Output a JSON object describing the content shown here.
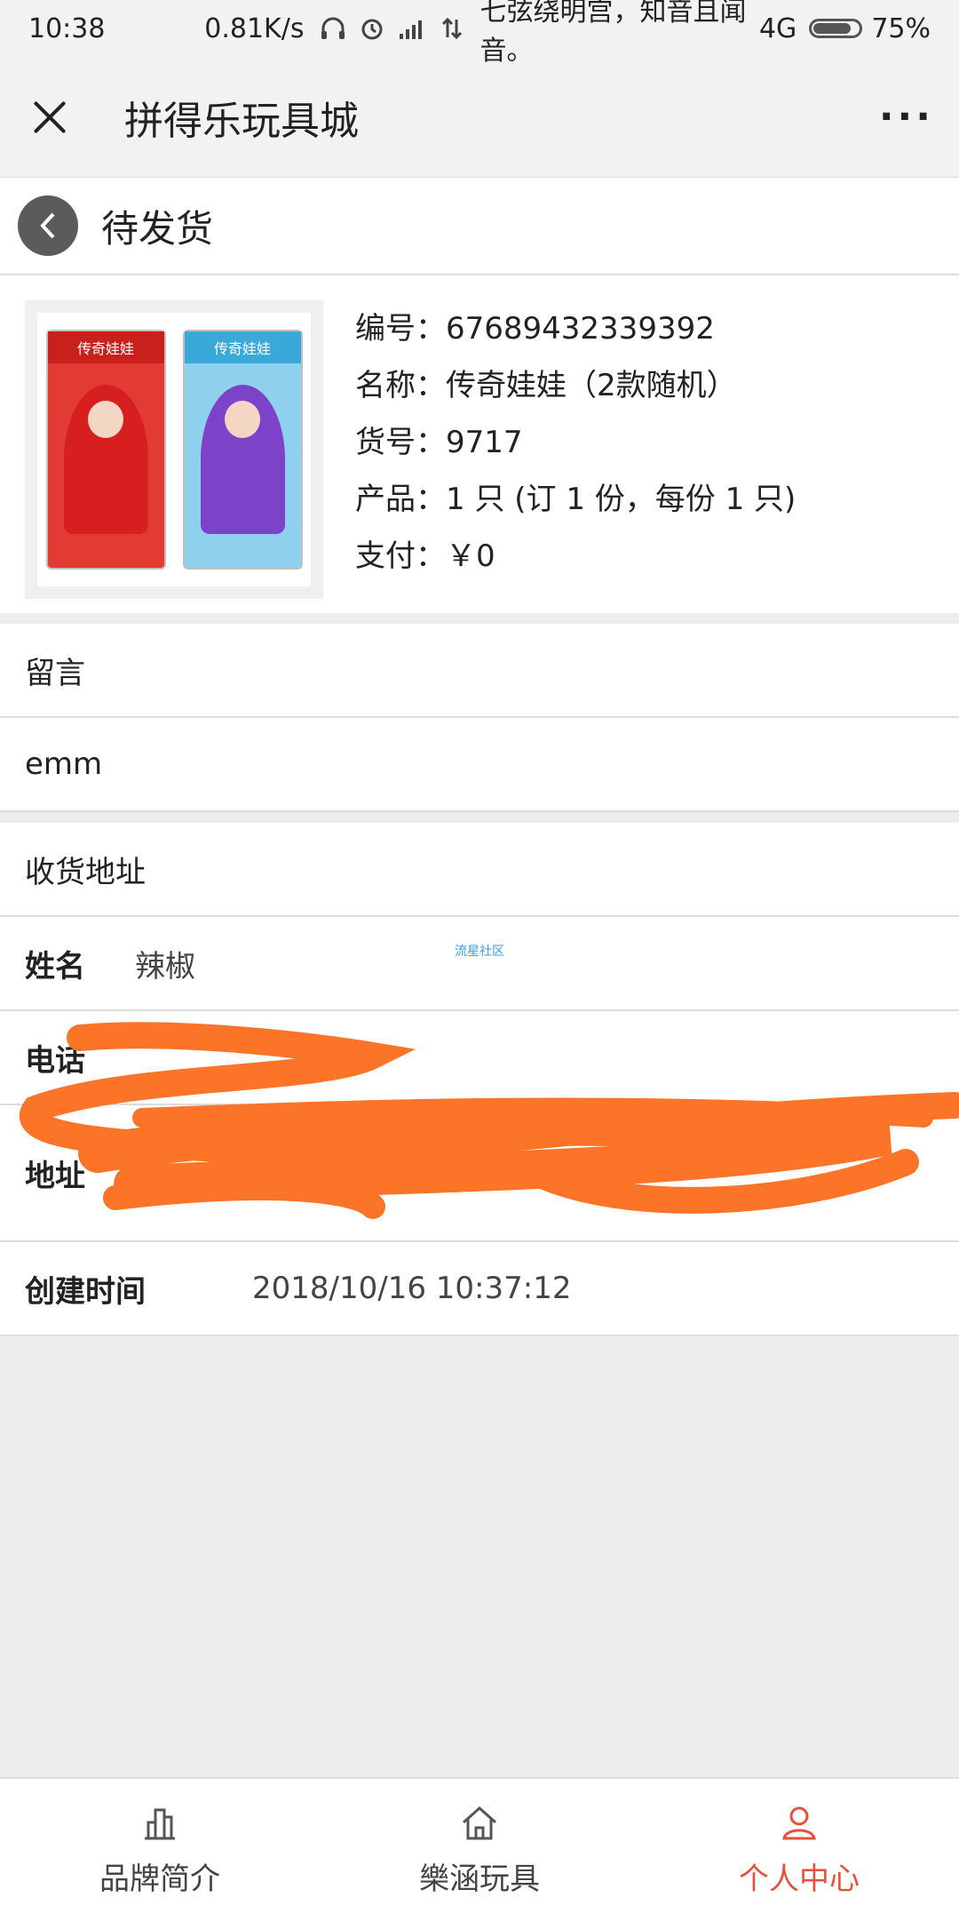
{
  "status_bar": {
    "time": "10:38",
    "speed": "0.81K/s",
    "motto": "七弦绕明宫，知音且闻音。",
    "network": "4G",
    "battery": "75%"
  },
  "header": {
    "title": "拼得乐玩具城"
  },
  "subheader": {
    "label": "待发货"
  },
  "product": {
    "id_line": "编号：67689432339392",
    "name_line": "名称：传奇娃娃（2款随机）",
    "sku_line": "货号：9717",
    "qty_line": "产品：1 只 (订 1 份，每份 1 只)",
    "pay_line": "支付：￥0",
    "box_label": "传奇娃娃"
  },
  "message": {
    "label": "留言",
    "value": "emm"
  },
  "address": {
    "section_label": "收货地址",
    "name_label": "姓名",
    "name_value": "辣椒",
    "watermark": "流星社区",
    "phone_label": "电话",
    "addr_label": "地址"
  },
  "created": {
    "label": "创建时间",
    "value": "2018/10/16 10:37:12"
  },
  "tabs": [
    {
      "label": "品牌简介"
    },
    {
      "label": "樂涵玩具"
    },
    {
      "label": "个人中心"
    }
  ],
  "colors": {
    "accent": "#e4523b",
    "redaction": "#fb7427"
  }
}
